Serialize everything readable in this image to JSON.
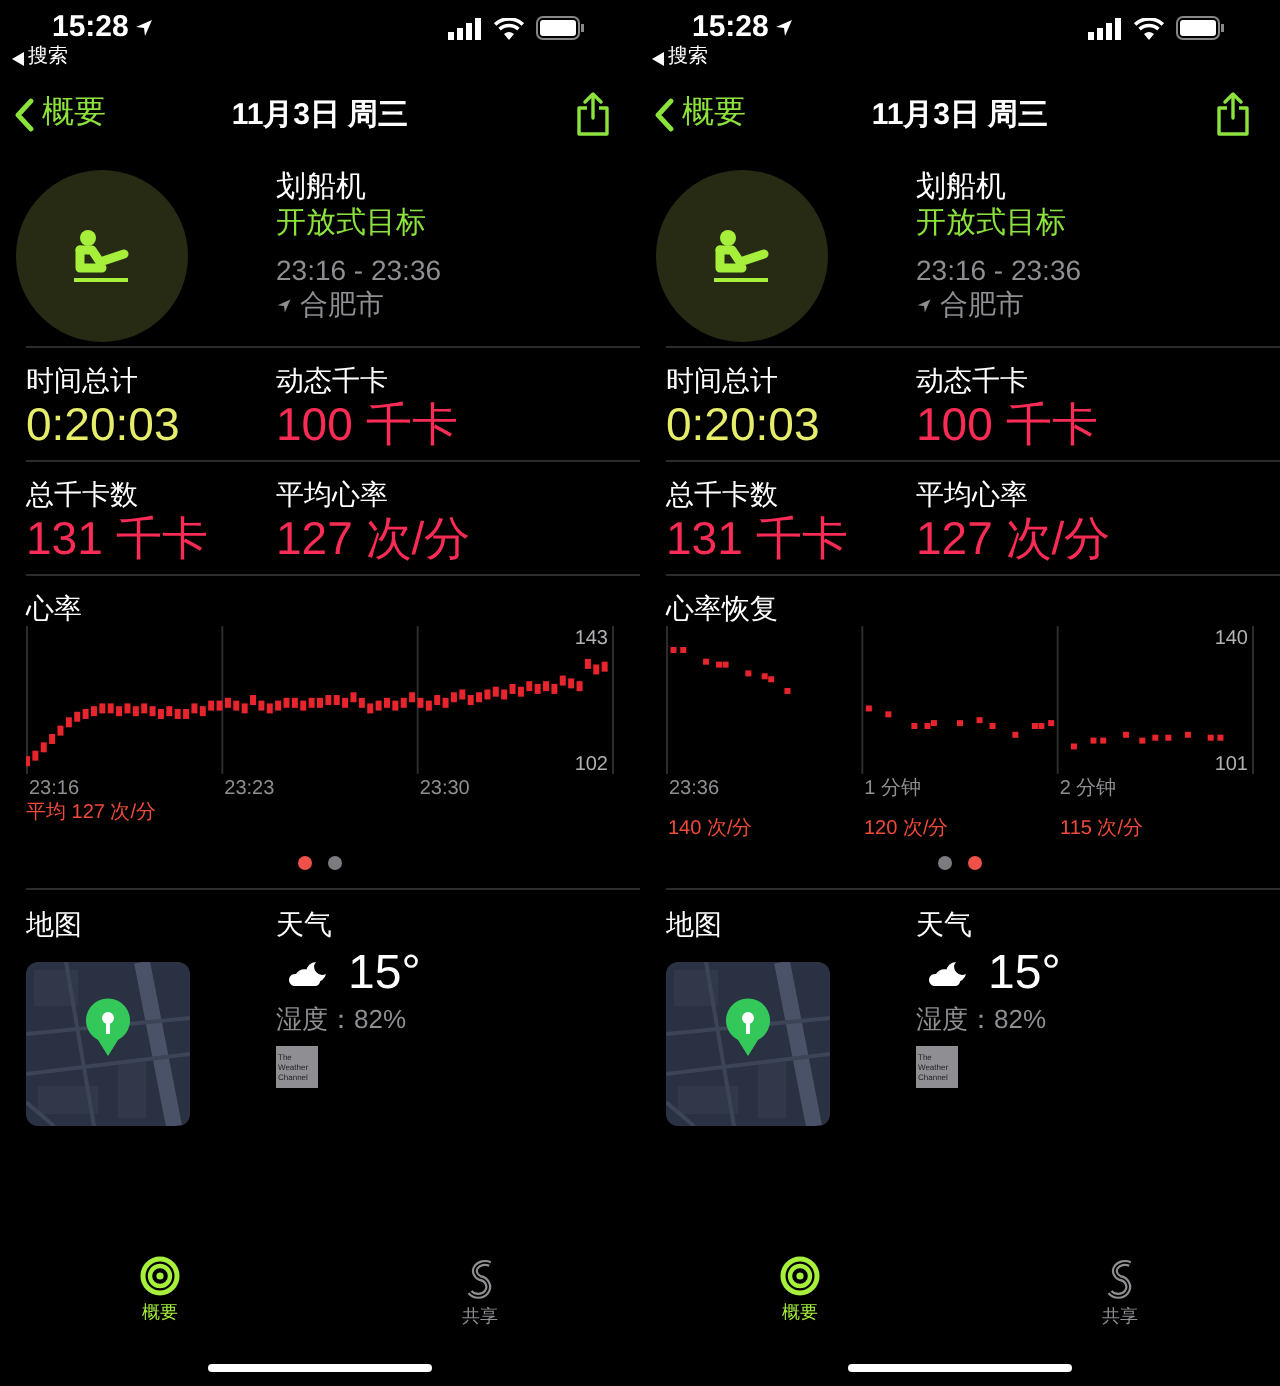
{
  "screens": [
    {
      "status_bar": {
        "time": "15:28",
        "back_app": "搜索"
      },
      "nav": {
        "back": "概要",
        "title": "11月3日 周三"
      },
      "workout": {
        "name": "划船机",
        "goal": "开放式目标",
        "time_range": "23:16 - 23:36",
        "location": "合肥市"
      },
      "metrics": [
        {
          "label": "时间总计",
          "value": "0:20:03",
          "kind": "time"
        },
        {
          "label": "动态千卡",
          "value": "100 千卡",
          "kind": "energy"
        },
        {
          "label": "总千卡数",
          "value": "131 千卡",
          "kind": "energy"
        },
        {
          "label": "平均心率",
          "value": "127 次/分",
          "kind": "energy"
        }
      ],
      "chart_section": {
        "title": "心率",
        "kind": "heart_rate",
        "note": "平均 127 次/分",
        "x_labels": [
          "23:16",
          "23:23",
          "23:30"
        ],
        "y_labels": [
          "143",
          "102"
        ]
      },
      "page_dots": [
        {
          "selected": true
        },
        {
          "selected": false
        }
      ],
      "map": {
        "title": "地图"
      },
      "weather": {
        "title": "天气",
        "temperature": "15°",
        "humidity": "湿度：82%",
        "logo_text": "The Weather Channel"
      },
      "tabs": [
        {
          "label": "概要",
          "kind": "summary",
          "selected": true
        },
        {
          "label": "共享",
          "kind": "sharing",
          "selected": false
        }
      ]
    },
    {
      "status_bar": {
        "time": "15:28",
        "back_app": "搜索"
      },
      "nav": {
        "back": "概要",
        "title": "11月3日 周三"
      },
      "workout": {
        "name": "划船机",
        "goal": "开放式目标",
        "time_range": "23:16 - 23:36",
        "location": "合肥市"
      },
      "metrics": [
        {
          "label": "时间总计",
          "value": "0:20:03",
          "kind": "time"
        },
        {
          "label": "动态千卡",
          "value": "100 千卡",
          "kind": "energy"
        },
        {
          "label": "总千卡数",
          "value": "131 千卡",
          "kind": "energy"
        },
        {
          "label": "平均心率",
          "value": "127 次/分",
          "kind": "energy"
        }
      ],
      "chart_section": {
        "title": "心率恢复",
        "kind": "recovery",
        "x_labels": [
          "23:36",
          "1 分钟",
          "2 分钟"
        ],
        "y_labels": [
          "140",
          "101"
        ],
        "captions": [
          "140 次/分",
          "120 次/分",
          "115 次/分"
        ]
      },
      "page_dots": [
        {
          "selected": false
        },
        {
          "selected": true
        }
      ],
      "map": {
        "title": "地图"
      },
      "weather": {
        "title": "天气",
        "temperature": "15°",
        "humidity": "湿度：82%",
        "logo_text": "The Weather Channel"
      },
      "tabs": [
        {
          "label": "概要",
          "kind": "summary",
          "selected": true
        },
        {
          "label": "共享",
          "kind": "sharing",
          "selected": false
        }
      ]
    }
  ]
}
